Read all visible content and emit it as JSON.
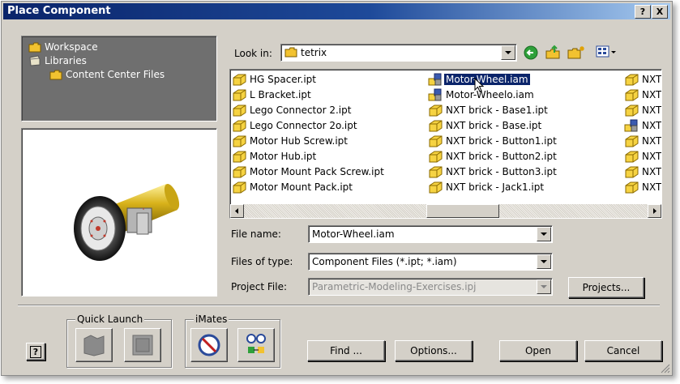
{
  "window": {
    "title": "Place Component",
    "help_label": "?",
    "close_label": "X"
  },
  "tree": {
    "items": [
      {
        "label": "Workspace",
        "icon": "folder-icon"
      },
      {
        "label": "Libraries",
        "icon": "libraries-icon"
      },
      {
        "label": "Content Center Files",
        "icon": "folder-icon"
      }
    ]
  },
  "look_in": {
    "label": "Look in:",
    "value": "tetrix"
  },
  "files": {
    "col1": [
      "HG Spacer.ipt",
      "L Bracket.ipt",
      "Lego Connector 2.ipt",
      "Lego Connector 2o.ipt",
      "Motor Hub Screw.ipt",
      "Motor Hub.ipt",
      "Motor Mount Pack Screw.ipt",
      "Motor Mount Pack.ipt"
    ],
    "col2": [
      "Motor-Wheel.iam",
      "Motor-Wheelo.iam",
      "NXT brick - Base1.ipt",
      "NXT brick - Base.ipt",
      "NXT brick - Button1.ipt",
      "NXT brick - Button2.ipt",
      "NXT brick - Button3.ipt",
      "NXT brick - Jack1.ipt"
    ],
    "col3": [
      "NXT",
      "NXT",
      "NXT",
      "NXT",
      "NXT",
      "NXT",
      "NXT",
      "NXT"
    ],
    "selected": "Motor-Wheel.iam"
  },
  "form": {
    "file_name_label": "File name:",
    "file_name_value": "Motor-Wheel.iam",
    "files_of_type_label": "Files of type:",
    "files_of_type_value": "Component Files (*.ipt; *.iam)",
    "project_file_label": "Project File:",
    "project_file_value": "Parametric-Modeling-Exercises.ipj",
    "projects_button": "Projects..."
  },
  "groups": {
    "quick_launch": "Quick Launch",
    "imates": "iMates"
  },
  "buttons": {
    "help": "?",
    "find": "Find ...",
    "options": "Options...",
    "open": "Open",
    "cancel": "Cancel"
  },
  "colors": {
    "titlebar": "#0a246a",
    "selection": "#0a246a",
    "tree_bg": "#6f6f6f",
    "folder": "#f2c230"
  }
}
